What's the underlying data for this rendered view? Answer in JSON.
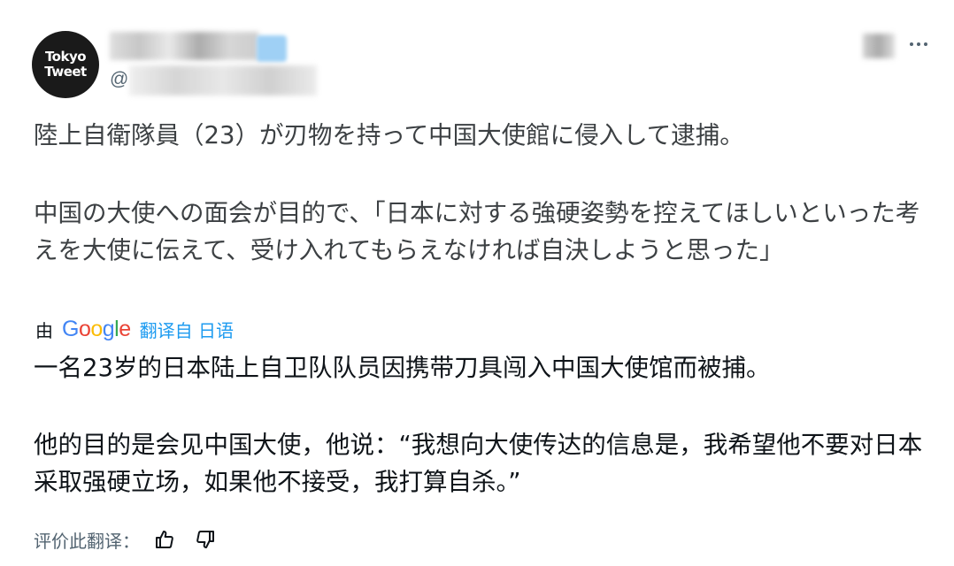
{
  "author": {
    "avatar_text_line1": "Tokyo",
    "avatar_text_line2": "Tweet",
    "handle_prefix": "@"
  },
  "tweet": {
    "original_line1": "陸上自衛隊員（23）が刃物を持って中国大使館に侵入して逮捕。",
    "original_line2": "中国の大使への面会が目的で、「日本に対する強硬姿勢を控えてほしいといった考えを大使に伝えて、受け入れてもらえなければ自決しようと思った」"
  },
  "translation": {
    "by_label": "由",
    "provider": "Google",
    "link_text": "翻译自 日语",
    "text_line1": "一名23岁的日本陆上自卫队队员因携带刀具闯入中国大使馆而被捕。",
    "text_line2": "他的目的是会见中国大使，他说：“我想向大使传达的信息是，我希望他不要对日本采取强硬立场，如果他不接受，我打算自杀。”"
  },
  "rating": {
    "label": "评价此翻译：",
    "thumbs_up_icon": "thumbs-up-icon",
    "thumbs_down_icon": "thumbs-down-icon"
  },
  "colors": {
    "link": "#1d9bf0",
    "secondary_text": "#536471",
    "google_blue": "#4285f4",
    "google_red": "#ea4335",
    "google_yellow": "#fbbc05",
    "google_green": "#34a853"
  }
}
